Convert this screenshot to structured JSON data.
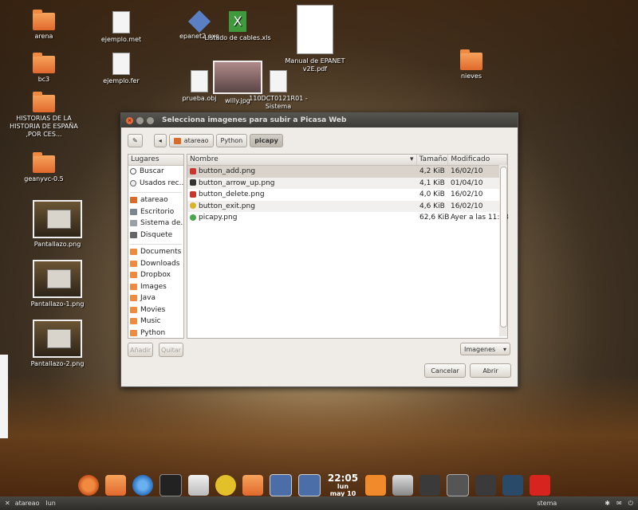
{
  "desktop": {
    "icons": [
      {
        "label": "arena"
      },
      {
        "label": "bc3"
      },
      {
        "label": "HISTORIAS DE LA HISTORIA DE ESPAÑA ,POR CES..."
      },
      {
        "label": "geanyvc-0.5"
      },
      {
        "label": "Pantallazo.png"
      },
      {
        "label": "Pantallazo-1.png"
      },
      {
        "label": "Pantallazo-2.png"
      },
      {
        "label": "ejemplo.met"
      },
      {
        "label": "ejemplo.fer"
      },
      {
        "label": "epanet2.exe"
      },
      {
        "label": "Listado de cables.xls"
      },
      {
        "label": "Manual de EPANET v2E.pdf"
      },
      {
        "label": "prueba.obj"
      },
      {
        "label": "willy.jpg"
      },
      {
        "label": "110DCT0121R01 - Sistema"
      },
      {
        "label": "nieves"
      }
    ]
  },
  "dialog": {
    "title": "Selecciona imagenes para subir a Picasa Web",
    "path": [
      "atareao",
      "Python",
      "picapy"
    ],
    "places_header": "Lugares",
    "places": [
      "Buscar",
      "Usados rec...",
      "atareao",
      "Escritorio",
      "Sistema de...",
      "Disquete",
      "Documents",
      "Downloads",
      "Dropbox",
      "Images",
      "Java",
      "Movies",
      "Music",
      "Python"
    ],
    "columns": {
      "name": "Nombre",
      "size": "Tamaño",
      "modified": "Modificado"
    },
    "files": [
      {
        "name": "button_add.png",
        "size": "4,2 KiB",
        "modified": "16/02/10"
      },
      {
        "name": "button_arrow_up.png",
        "size": "4,1 KiB",
        "modified": "01/04/10"
      },
      {
        "name": "button_delete.png",
        "size": "4,0 KiB",
        "modified": "16/02/10"
      },
      {
        "name": "button_exit.png",
        "size": "4,6 KiB",
        "modified": "16/02/10"
      },
      {
        "name": "picapy.png",
        "size": "62,6 KiB",
        "modified": "Ayer a las 11:48"
      }
    ],
    "add_label": "Añadir",
    "remove_label": "Quitar",
    "filter_value": "Imagenes",
    "cancel_label": "Cancelar",
    "open_label": "Abrir"
  },
  "panel": {
    "clock_time": "22:05",
    "clock_day": "lun",
    "clock_date": "may 10",
    "taskbar_user": "atareao",
    "taskbar_lun": "lun",
    "taskbar_sistema": "stema"
  }
}
